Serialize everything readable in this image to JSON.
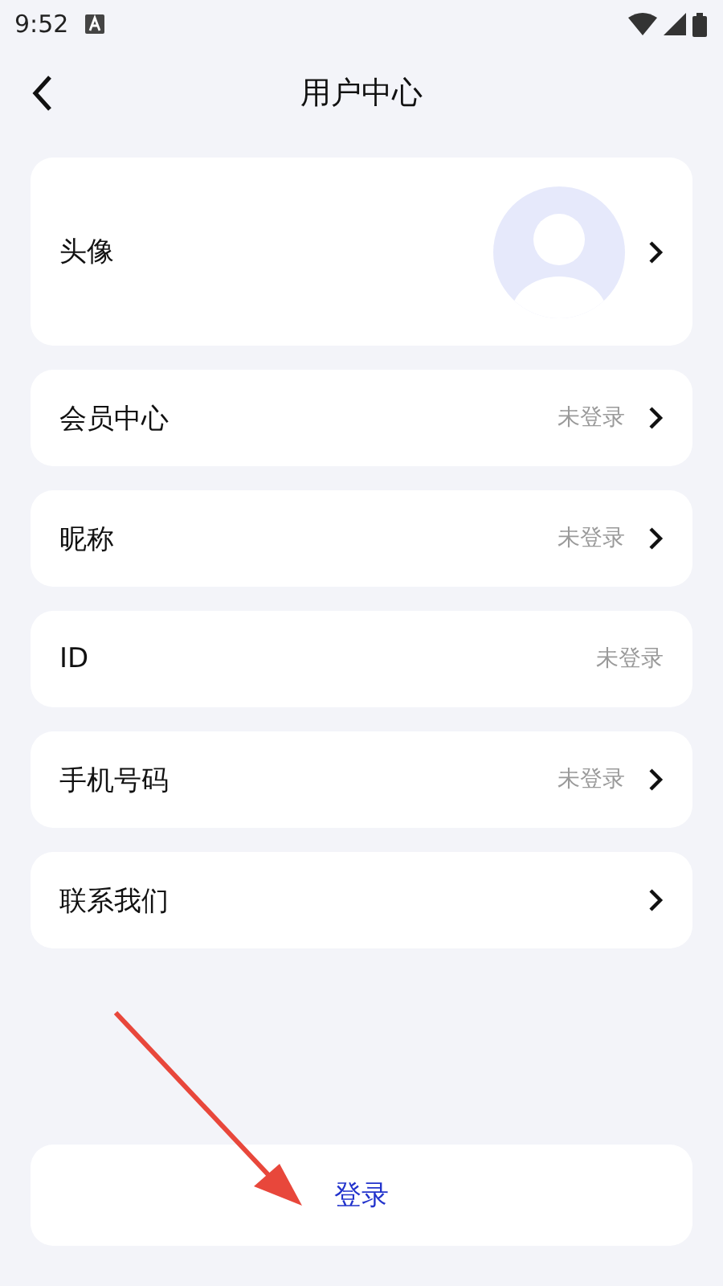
{
  "status_bar": {
    "time": "9:52"
  },
  "header": {
    "title": "用户中心"
  },
  "avatar_row": {
    "label": "头像",
    "has_arrow": true
  },
  "rows": [
    {
      "label": "会员中心",
      "value": "未登录",
      "has_arrow": true
    },
    {
      "label": "昵称",
      "value": "未登录",
      "has_arrow": true
    },
    {
      "label": "ID",
      "value": "未登录",
      "has_arrow": false
    },
    {
      "label": "手机号码",
      "value": "未登录",
      "has_arrow": true
    },
    {
      "label": "联系我们",
      "has_arrow": true
    }
  ],
  "login_button": {
    "label": "登录"
  }
}
